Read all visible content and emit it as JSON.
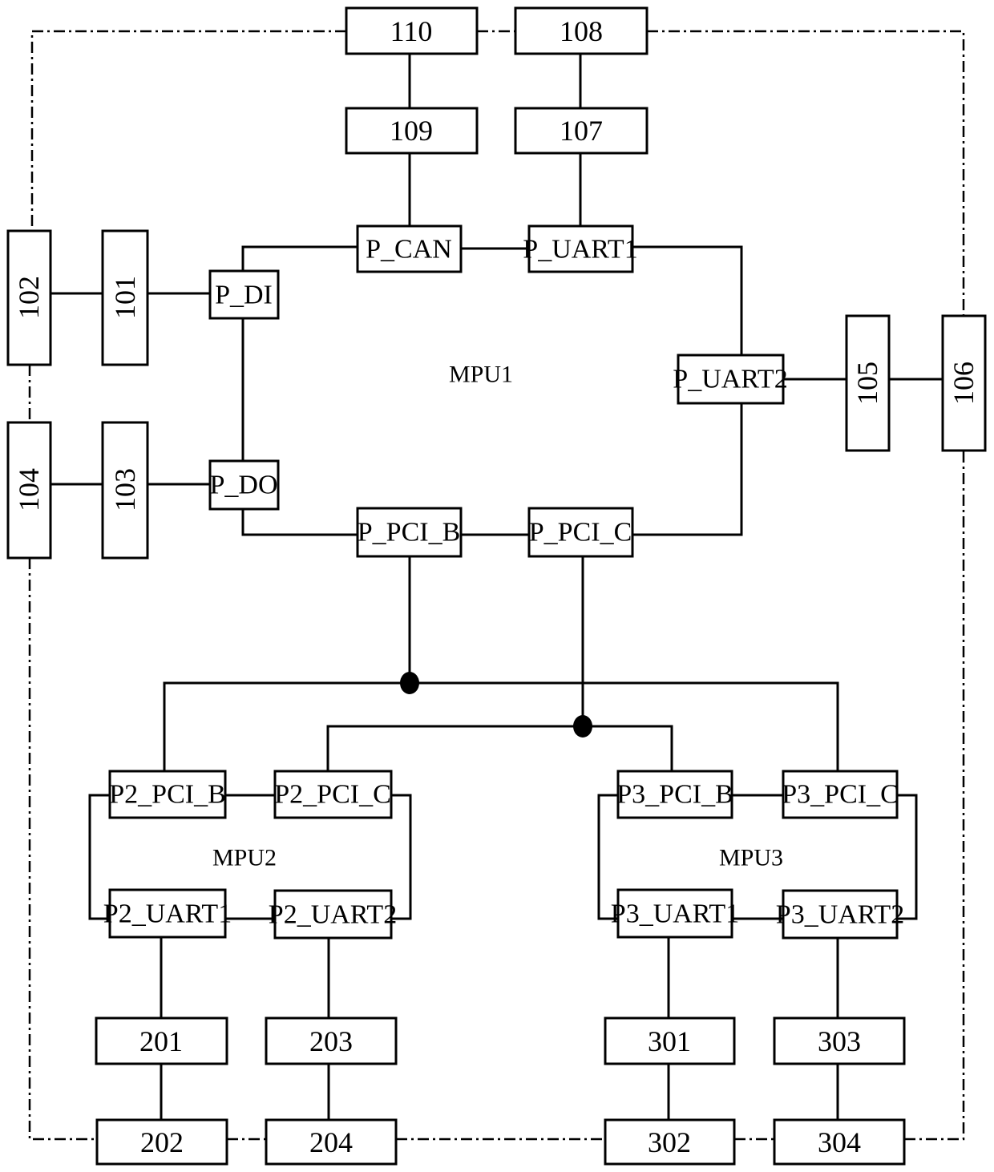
{
  "diagram": {
    "colors": {
      "line": "#000000",
      "background": "#ffffff"
    },
    "processors": [
      {
        "id": "mpu1",
        "label": "MPU1"
      },
      {
        "id": "mpu2",
        "label": "MPU2"
      },
      {
        "id": "mpu3",
        "label": "MPU3"
      }
    ],
    "ports": {
      "p_can": "P_CAN",
      "p_uart1": "P_UART1",
      "p_di": "P_DI",
      "p_uart2": "P_UART2",
      "p_do": "P_DO",
      "p_pci_b": "P_PCI_B",
      "p_pci_c": "P_PCI_C",
      "p2_pci_b": "P2_PCI_B",
      "p2_pci_c": "P2_PCI_C",
      "p2_uart1": "P2_UART1",
      "p2_uart2": "P2_UART2",
      "p3_pci_b": "P3_PCI_B",
      "p3_pci_c": "P3_PCI_C",
      "p3_uart1": "P3_UART1",
      "p3_uart2": "P3_UART2"
    },
    "modules": {
      "m110": "110",
      "m108": "108",
      "m109": "109",
      "m107": "107",
      "m102": "102",
      "m101": "101",
      "m104": "104",
      "m103": "103",
      "m105": "105",
      "m106": "106",
      "m201": "201",
      "m203": "203",
      "m202": "202",
      "m204": "204",
      "m301": "301",
      "m303": "303",
      "m302": "302",
      "m304": "304"
    },
    "connections_solid": [
      [
        "110",
        "109"
      ],
      [
        "109",
        "P_CAN"
      ],
      [
        "108",
        "107"
      ],
      [
        "107",
        "P_UART1"
      ],
      [
        "P_CAN",
        "P_UART1"
      ],
      [
        "P_CAN",
        "P_DI"
      ],
      [
        "P_UART1",
        "P_UART2"
      ],
      [
        "102",
        "101"
      ],
      [
        "101",
        "P_DI"
      ],
      [
        "104",
        "103"
      ],
      [
        "103",
        "P_DO"
      ],
      [
        "P_DI",
        "P_DO"
      ],
      [
        "P_DO",
        "P_PCI_B"
      ],
      [
        "P_PCI_B",
        "P_PCI_C"
      ],
      [
        "P_PCI_C",
        "P_UART2"
      ],
      [
        "P_UART2",
        "105"
      ],
      [
        "105",
        "106"
      ],
      [
        "P_PCI_B",
        "P2_PCI_B"
      ],
      [
        "P_PCI_B",
        "P3_PCI_C"
      ],
      [
        "P_PCI_C",
        "P2_PCI_C"
      ],
      [
        "P_PCI_C",
        "P3_PCI_B"
      ],
      [
        "P2_PCI_B",
        "P2_PCI_C"
      ],
      [
        "P2_PCI_B",
        "P2_UART1"
      ],
      [
        "P2_PCI_C",
        "P2_UART2"
      ],
      [
        "P2_UART1",
        "P2_UART2"
      ],
      [
        "P3_PCI_B",
        "P3_PCI_C"
      ],
      [
        "P3_PCI_B",
        "P3_UART1"
      ],
      [
        "P3_PCI_C",
        "P3_UART2"
      ],
      [
        "P3_UART1",
        "P3_UART2"
      ],
      [
        "P2_UART1",
        "201"
      ],
      [
        "201",
        "202"
      ],
      [
        "P2_UART2",
        "203"
      ],
      [
        "203",
        "204"
      ],
      [
        "P3_UART1",
        "301"
      ],
      [
        "301",
        "302"
      ],
      [
        "P3_UART2",
        "303"
      ],
      [
        "303",
        "304"
      ]
    ],
    "connections_dashdot": [
      [
        "110",
        "108"
      ],
      [
        "110",
        "102"
      ],
      [
        "108",
        "106"
      ],
      [
        "102",
        "104"
      ],
      [
        "104",
        "202"
      ],
      [
        "202",
        "204"
      ],
      [
        "204",
        "302"
      ],
      [
        "302",
        "304"
      ],
      [
        "304",
        "106"
      ]
    ]
  }
}
